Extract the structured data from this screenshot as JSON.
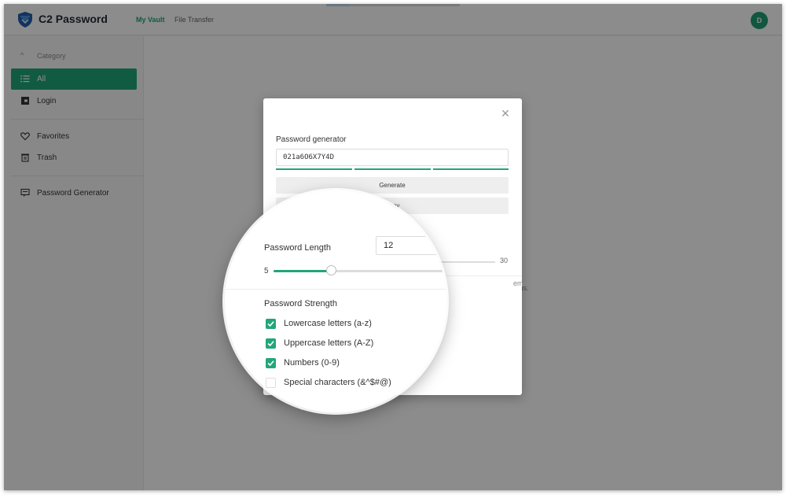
{
  "app": {
    "name": "C2 Password"
  },
  "nav": {
    "my_vault": "My Vault",
    "file_transfer": "File Transfer"
  },
  "user": {
    "initial": "D"
  },
  "sidebar": {
    "category_header": "Category",
    "items": [
      {
        "label": "All",
        "icon": "list-icon",
        "active": true
      },
      {
        "label": "Login",
        "icon": "login-icon",
        "active": false
      },
      {
        "label": "Favorites",
        "icon": "heart-icon",
        "active": false
      },
      {
        "label": "Trash",
        "icon": "trash-icon",
        "active": false
      },
      {
        "label": "Password Generator",
        "icon": "generator-icon",
        "active": false
      }
    ]
  },
  "main": {
    "empty_tail": "ems."
  },
  "modal": {
    "title": "Password generator",
    "password": "021a6O6X7Y4D",
    "generate_label": "Generate",
    "copy_label": "Copy",
    "length_label": "Password Length",
    "length_value": "12",
    "length_min": "5",
    "length_max": "30",
    "strength_label": "Password Strength",
    "options": [
      {
        "label": "Lowercase letters (a-z)",
        "checked": true
      },
      {
        "label": "Uppercase letters (A-Z)",
        "checked": true
      },
      {
        "label": "Numbers (0-9)",
        "checked": true
      },
      {
        "label": "Special characters (&^$#@)",
        "checked": false
      }
    ]
  },
  "colors": {
    "accent": "#22a67a",
    "brand_dark": "#1f2a3a"
  }
}
